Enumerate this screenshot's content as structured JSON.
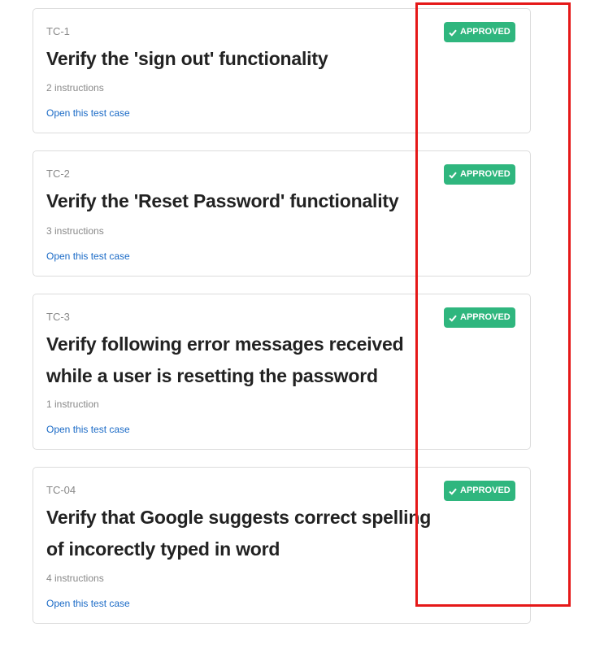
{
  "cards": [
    {
      "id": "TC-1",
      "title": "Verify the 'sign out' functionality",
      "count": "2 instructions",
      "link": "Open this test case",
      "status": "APPROVED"
    },
    {
      "id": "TC-2",
      "title": "Verify the 'Reset Password' functionality",
      "count": "3 instructions",
      "link": "Open this test case",
      "status": "APPROVED"
    },
    {
      "id": "TC-3",
      "title": "Verify following error messages received while a user is resetting the password",
      "count": "1 instruction",
      "link": "Open this test case",
      "status": "APPROVED"
    },
    {
      "id": "TC-04",
      "title": "Verify that Google suggests correct spelling of incorectly typed in word",
      "count": "4 instructions",
      "link": "Open this test case",
      "status": "APPROVED"
    }
  ],
  "colors": {
    "approved": "#2fb67e",
    "link": "#1a6ac6",
    "highlight": "#e51818"
  },
  "icons": {
    "badge": "check-icon"
  }
}
